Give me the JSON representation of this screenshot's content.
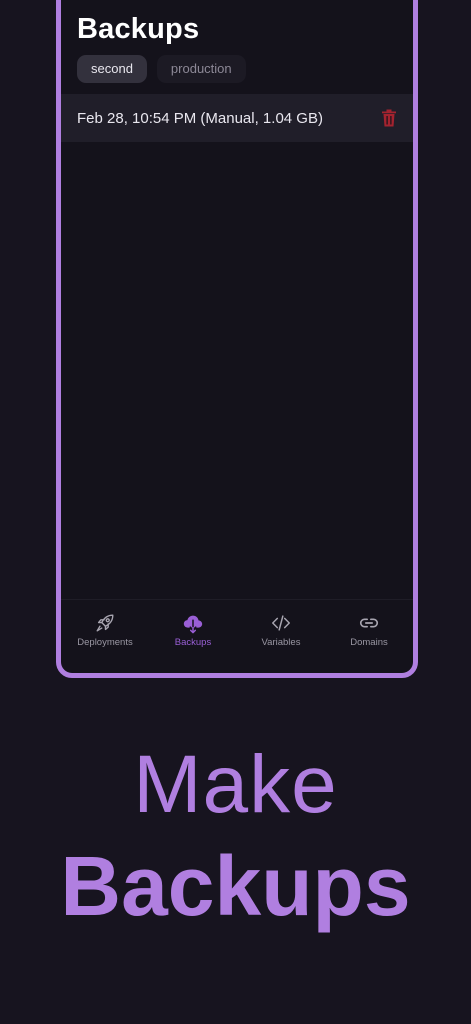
{
  "screen": {
    "title": "Backups",
    "environments": [
      {
        "label": "second",
        "active": true
      },
      {
        "label": "production",
        "active": false
      }
    ],
    "backups": [
      {
        "label": "Feb 28, 10:54 PM (Manual, 1.04 GB)"
      }
    ]
  },
  "tabbar": {
    "items": [
      {
        "label": "Deployments",
        "icon": "rocket-icon",
        "active": false
      },
      {
        "label": "Backups",
        "icon": "cloud-download-icon",
        "active": true
      },
      {
        "label": "Variables",
        "icon": "code-icon",
        "active": false
      },
      {
        "label": "Domains",
        "icon": "link-icon",
        "active": false
      }
    ]
  },
  "promo": {
    "line1": "Make",
    "line2": "Backups"
  },
  "colors": {
    "background": "#17141f",
    "accent": "#b07fe0",
    "active_tab": "#9a5fd6",
    "delete": "#a3232f"
  }
}
